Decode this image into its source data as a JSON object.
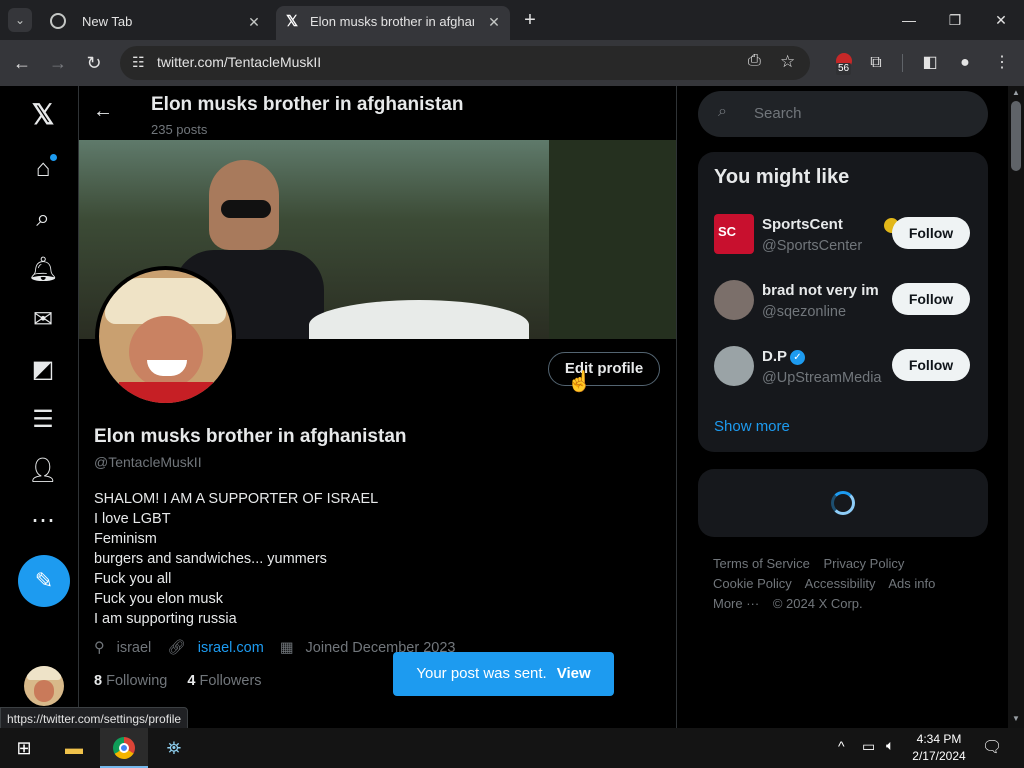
{
  "browser": {
    "tabs": [
      {
        "title": "New Tab",
        "active": false
      },
      {
        "title": "Elon musks brother in afghanis",
        "active": true
      }
    ],
    "url": "twitter.com/TentacleMuskII",
    "extension_badge": "56",
    "status_url": "https://twitter.com/settings/profile"
  },
  "header": {
    "title": "Elon musks brother in afghanistan",
    "posts": "235 posts"
  },
  "profile": {
    "edit_button": "Edit profile",
    "name": "Elon musks brother in afghanistan",
    "handle": "@TentacleMuskII",
    "bio": [
      "SHALOM! I AM A SUPPORTER OF ISRAEL",
      "I love LGBT",
      "Feminism",
      "burgers and sandwiches... yummers",
      "Fuck you all",
      "Fuck you elon musk",
      "I am supporting russia"
    ],
    "location": "israel",
    "link": "israel.com",
    "joined": "Joined December 2023",
    "following_count": "8",
    "following_label": "Following",
    "followers_count": "4",
    "followers_label": "Followers"
  },
  "toast": {
    "text": "Your post was sent.",
    "action": "View"
  },
  "sidebar": {
    "search_placeholder": "Search",
    "wtf_title": "You might like",
    "suggestions": [
      {
        "name": "SportsCent",
        "handle": "@SportsCenter",
        "button": "Follow",
        "badge_color": "#e2b719"
      },
      {
        "name": "brad not very im",
        "handle": "@sqezonline",
        "button": "Follow"
      },
      {
        "name": "D.P",
        "handle": "@UpStreamMedia",
        "button": "Follow",
        "badge_color": "#1d9bf0"
      }
    ],
    "show_more": "Show more",
    "footer": [
      "Terms of Service",
      "Privacy Policy",
      "Cookie Policy",
      "Accessibility",
      "Ads info",
      "More ···",
      "© 2024 X Corp."
    ]
  },
  "taskbar": {
    "time": "4:34 PM",
    "date": "2/17/2024"
  },
  "colors": {
    "accent": "#1d9bf0",
    "background": "#000000"
  }
}
